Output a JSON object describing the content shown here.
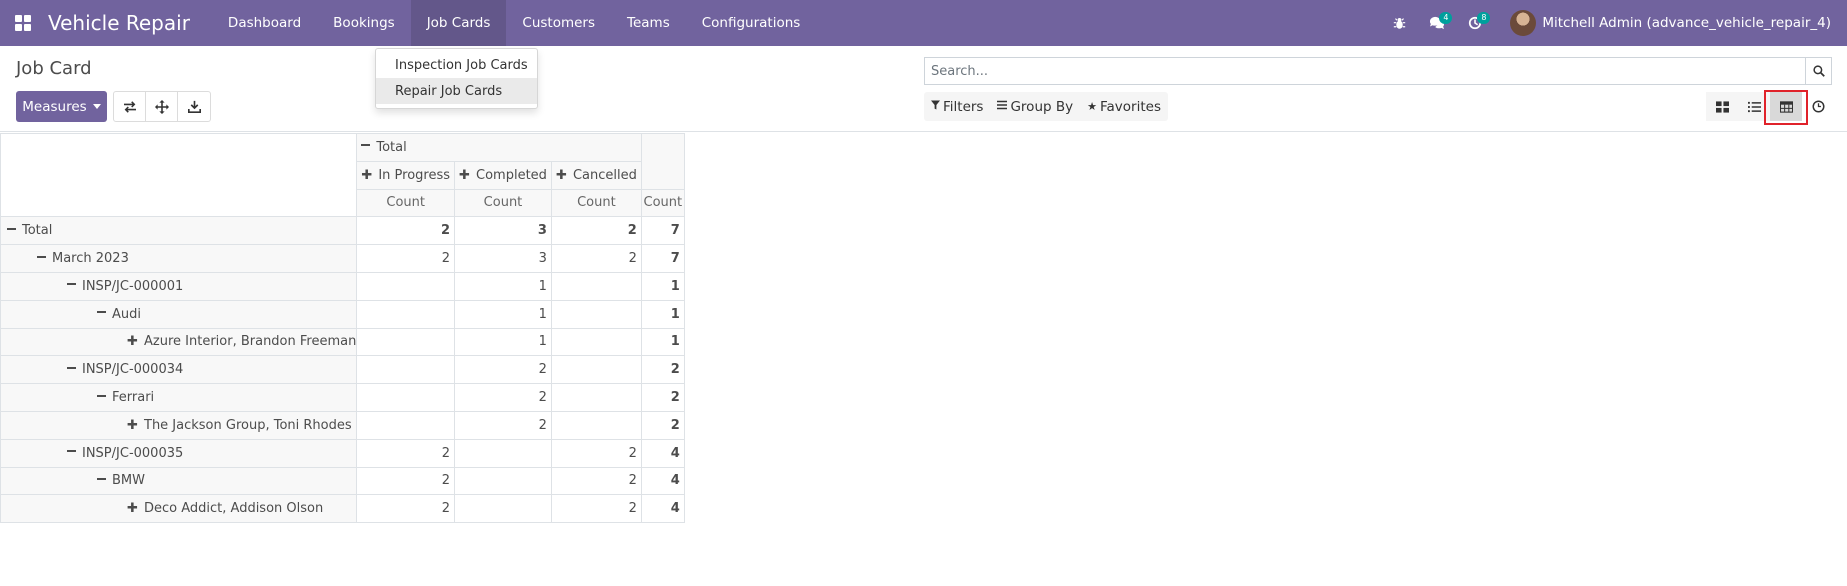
{
  "navbar": {
    "brand": "Vehicle Repair",
    "menu": [
      "Dashboard",
      "Bookings",
      "Job Cards",
      "Customers",
      "Teams",
      "Configurations"
    ],
    "messages_badge": "4",
    "activities_badge": "8",
    "user": "Mitchell Admin (advance_vehicle_repair_4)"
  },
  "dropdown": {
    "items": [
      "Inspection Job Cards",
      "Repair Job Cards"
    ]
  },
  "control_panel": {
    "title": "Job Card",
    "measures_label": "Measures",
    "search_placeholder": "Search...",
    "filters_label": "Filters",
    "groupby_label": "Group By",
    "favorites_label": "Favorites"
  },
  "pivot": {
    "col_total": "Total",
    "col_groups": [
      "In Progress",
      "Completed",
      "Cancelled"
    ],
    "measure": "Count",
    "rows": [
      {
        "label": "Total",
        "values": [
          "2",
          "3",
          "2"
        ],
        "total": "7"
      },
      {
        "label": "March 2023",
        "values": [
          "2",
          "3",
          "2"
        ],
        "total": "7"
      },
      {
        "label": "INSP/JC-000001",
        "values": [
          "",
          "1",
          ""
        ],
        "total": "1"
      },
      {
        "label": "Audi",
        "values": [
          "",
          "1",
          ""
        ],
        "total": "1"
      },
      {
        "label": "Azure Interior, Brandon Freeman",
        "values": [
          "",
          "1",
          ""
        ],
        "total": "1"
      },
      {
        "label": "INSP/JC-000034",
        "values": [
          "",
          "2",
          ""
        ],
        "total": "2"
      },
      {
        "label": "Ferrari",
        "values": [
          "",
          "2",
          ""
        ],
        "total": "2"
      },
      {
        "label": "The Jackson Group, Toni Rhodes",
        "values": [
          "",
          "2",
          ""
        ],
        "total": "2"
      },
      {
        "label": "INSP/JC-000035",
        "values": [
          "2",
          "",
          "2"
        ],
        "total": "4"
      },
      {
        "label": "BMW",
        "values": [
          "2",
          "",
          "2"
        ],
        "total": "4"
      },
      {
        "label": "Deco Addict, Addison Olson",
        "values": [
          "2",
          "",
          "2"
        ],
        "total": "4"
      }
    ]
  }
}
